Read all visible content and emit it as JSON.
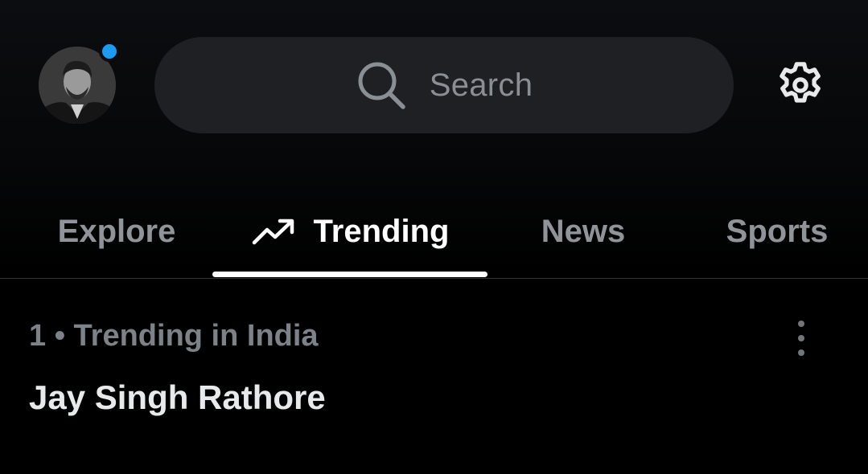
{
  "header": {
    "avatar_icon": "profile-avatar",
    "has_notification": true,
    "notification_color": "#1d9bf0",
    "search_placeholder": "Search",
    "settings_icon": "gear-icon"
  },
  "tabs": [
    {
      "label": "Explore",
      "active": false
    },
    {
      "label": "Trending",
      "active": true,
      "icon": "trending-up-icon"
    },
    {
      "label": "News",
      "active": false
    },
    {
      "label": "Sports",
      "active": false
    }
  ],
  "trends": [
    {
      "meta": "1 • Trending in India",
      "title": "Jay Singh Rathore",
      "more_icon": "more-vertical-icon"
    }
  ],
  "colors": {
    "background": "#000000",
    "search_bg": "#1e2024",
    "muted_text": "#7d8288",
    "primary_text": "#e7e9ea",
    "accent": "#1d9bf0"
  }
}
